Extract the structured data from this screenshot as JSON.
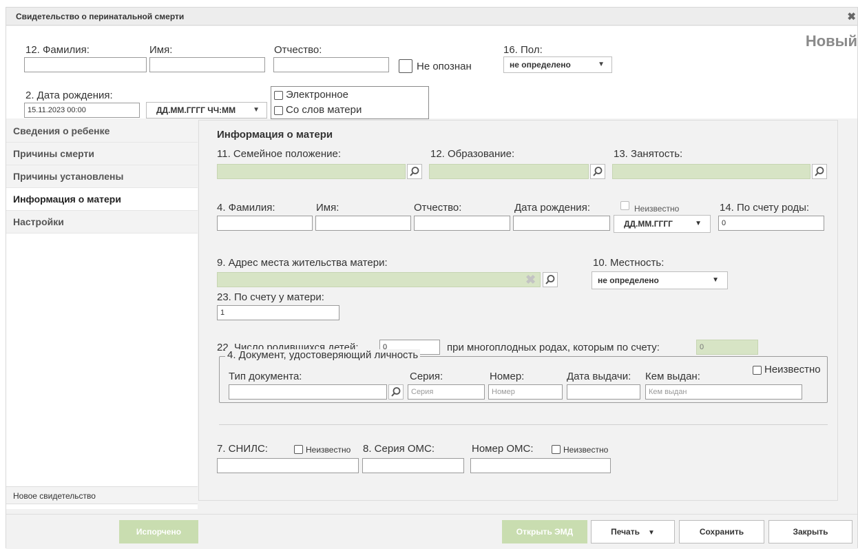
{
  "window": {
    "title": "Свидетельство о перинатальной смерти",
    "status": "Новый"
  },
  "header": {
    "surname_label": "12. Фамилия:",
    "name_label": "Имя:",
    "patronymic_label": "Отчество:",
    "unidentified_label": "Не опознан",
    "sex_label": "16. Пол:",
    "sex_value": "не определено",
    "birthdate_label": "2. Дата рождения:",
    "birthdate_value": "15.11.2023 00:00",
    "date_format": "ДД.ММ.ГГГГ ЧЧ:ММ",
    "electronic_label": "Электронное",
    "from_mother_label": "Со слов матери"
  },
  "sidebar": {
    "items": [
      {
        "label": "Сведения о ребенке"
      },
      {
        "label": "Причины смерти"
      },
      {
        "label": "Причины установлены"
      },
      {
        "label": "Информация о матери"
      },
      {
        "label": "Настройки"
      }
    ],
    "footer": "Новое свидетельство"
  },
  "mother": {
    "section_title": "Информация о матери",
    "marital_label": "11. Семейное положение:",
    "education_label": "12. Образование:",
    "employment_label": "13. Занятость:",
    "surname_label": "4. Фамилия:",
    "name_label": "Имя:",
    "patronymic_label": "Отчество:",
    "birthdate_label": "Дата рождения:",
    "unknown_label": "Неизвестно",
    "birth_order_label": "14. По счету роды:",
    "birth_order_value": "0",
    "date_format": "ДД.ММ.ГГГГ",
    "address_label": "9. Адрес места жительства матери:",
    "locality_label": "10. Местность:",
    "locality_value": "не определено",
    "child_order_label": "23. По счету у матери:",
    "child_order_value": "1",
    "children_count_label": "22. Число родившихся детей:",
    "children_count_value": "0",
    "multiple_label": "при многоплодных родах, которым по счету:",
    "multiple_value": "0"
  },
  "document": {
    "legend": "4. Документ, удостоверяющий личность",
    "unknown_label": "Неизвестно",
    "type_label": "Тип документа:",
    "series_label": "Серия:",
    "series_placeholder": "Серия",
    "number_label": "Номер:",
    "number_placeholder": "Номер",
    "issue_date_label": "Дата выдачи:",
    "issued_by_label": "Кем выдан:",
    "issued_by_placeholder": "Кем выдан"
  },
  "insurance": {
    "snils_label": "7. СНИЛС:",
    "snils_unknown": "Неизвестно",
    "oms_series_label": "8. Серия ОМС:",
    "oms_number_label": "Номер ОМС:",
    "oms_unknown": "Неизвестно"
  },
  "buttons": {
    "spoiled": "Испорчено",
    "open_emd": "Открыть ЭМД",
    "print": "Печать",
    "save": "Сохранить",
    "close": "Закрыть"
  }
}
